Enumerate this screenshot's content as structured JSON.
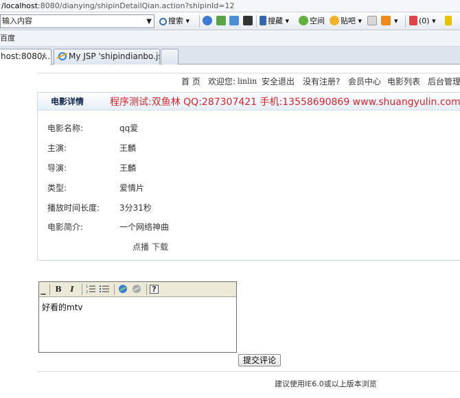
{
  "browser": {
    "address": {
      "host": "/localhost",
      "rest": ":8080/dianying/shipinDetailQian.action?shipinId=12"
    },
    "search_placeholder": "输入内容",
    "toolbar": {
      "search_label": "搜索",
      "favorites_label": "搜藏",
      "space_label": "空间",
      "tieba_label": "贴吧",
      "mail_count": "(0)"
    },
    "row3_label": "百度",
    "tabs": [
      {
        "label": "host:8080/...",
        "close": "×"
      },
      {
        "label": "My JSP 'shipindianbo.js..."
      }
    ]
  },
  "nav": {
    "home": "首 页",
    "welcome_prefix": "欢迎您:",
    "username": "linlin",
    "logout": "安全退出",
    "register": "没有注册?",
    "member": "会员中心",
    "movie_list": "电影列表",
    "admin": "后台管理"
  },
  "detail": {
    "title": "电影详情",
    "promo": "程序测试:双鱼林 QQ:287307421 手机:13558690869 www.shuangyulin.com",
    "rows": [
      {
        "label": "电影名称:",
        "value": "qq爱"
      },
      {
        "label": "主演:",
        "value": "王麟"
      },
      {
        "label": "导演:",
        "value": "王麟"
      },
      {
        "label": "类型:",
        "value": "爱情片"
      },
      {
        "label": "播放时间长度:",
        "value": "3分31秒"
      },
      {
        "label": "电影简介:",
        "value": "一个网络神曲"
      }
    ],
    "play": "点播",
    "download": "下载"
  },
  "comment": {
    "text": "好看的mtv",
    "submit": "提交评论",
    "toolbar": {
      "bold": "B",
      "italic": "I",
      "help": "?"
    }
  },
  "footer": "建议使用IE6.0或以上版本浏览"
}
